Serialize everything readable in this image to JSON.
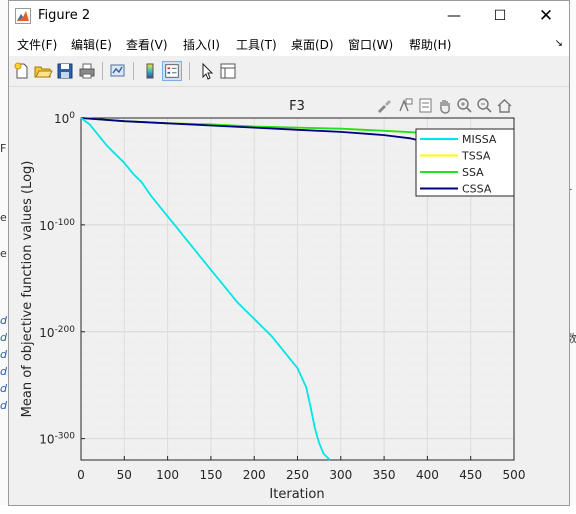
{
  "window": {
    "title": "Figure 2",
    "controls": {
      "minimize": "—",
      "maximize": "☐",
      "close": "✕"
    }
  },
  "menu": [
    "文件(F)",
    "编辑(E)",
    "查看(V)",
    "插入(I)",
    "工具(T)",
    "桌面(D)",
    "窗口(W)",
    "帮助(H)"
  ],
  "toolbar": {
    "buttons": [
      "new-figure",
      "open-file",
      "save",
      "print",
      "link-plot",
      "insert-colorbar",
      "insert-legend",
      "edit-plot",
      "property-inspector"
    ]
  },
  "axes_toolbar": [
    "brush",
    "data-tips",
    "pan",
    "zoom-in",
    "zoom-out",
    "restore-view"
  ],
  "background_fragments": {
    "left": [
      "F",
      "e",
      "e"
    ],
    "right": [
      "数"
    ]
  },
  "chart_data": {
    "type": "line",
    "title": "F3",
    "xlabel": "Iteration",
    "ylabel": "Mean of objective function values (Log)",
    "xlim": [
      0,
      500
    ],
    "ylim_exponent": [
      -320,
      0
    ],
    "yscale": "log",
    "x_ticks": [
      "0",
      "50",
      "100",
      "150",
      "200",
      "250",
      "300",
      "350",
      "400",
      "450",
      "500"
    ],
    "y_ticks": [
      {
        "base": "10",
        "exp": "0",
        "value": 0
      },
      {
        "base": "10",
        "exp": "-100",
        "value": -100
      },
      {
        "base": "10",
        "exp": "-200",
        "value": -200
      },
      {
        "base": "10",
        "exp": "-300",
        "value": -300
      }
    ],
    "grid": true,
    "legend_position": "top-right",
    "series": [
      {
        "name": "MISSA",
        "color": "#00e5e5",
        "points": [
          [
            0,
            0
          ],
          [
            10,
            -6
          ],
          [
            20,
            -16
          ],
          [
            30,
            -26
          ],
          [
            40,
            -34
          ],
          [
            50,
            -42
          ],
          [
            60,
            -52
          ],
          [
            70,
            -60
          ],
          [
            80,
            -72
          ],
          [
            90,
            -82
          ],
          [
            100,
            -92
          ],
          [
            110,
            -102
          ],
          [
            120,
            -112
          ],
          [
            130,
            -122
          ],
          [
            140,
            -132
          ],
          [
            150,
            -142
          ],
          [
            160,
            -152
          ],
          [
            170,
            -162
          ],
          [
            180,
            -172
          ],
          [
            190,
            -180
          ],
          [
            200,
            -188
          ],
          [
            210,
            -196
          ],
          [
            220,
            -204
          ],
          [
            230,
            -214
          ],
          [
            240,
            -224
          ],
          [
            250,
            -234
          ],
          [
            260,
            -252
          ],
          [
            265,
            -270
          ],
          [
            270,
            -290
          ],
          [
            275,
            -304
          ],
          [
            280,
            -314
          ],
          [
            290,
            -322
          ]
        ]
      },
      {
        "name": "TSSA",
        "color": "#ffff00",
        "points": [
          [
            0,
            0
          ],
          [
            50,
            -3
          ],
          [
            100,
            -5
          ],
          [
            150,
            -6
          ],
          [
            200,
            -8
          ],
          [
            250,
            -9
          ],
          [
            300,
            -10
          ],
          [
            350,
            -12
          ],
          [
            400,
            -14
          ],
          [
            450,
            -17
          ],
          [
            500,
            -22
          ]
        ]
      },
      {
        "name": "SSA",
        "color": "#22e022",
        "points": [
          [
            0,
            0
          ],
          [
            50,
            -3
          ],
          [
            100,
            -5
          ],
          [
            150,
            -6
          ],
          [
            200,
            -8
          ],
          [
            250,
            -9
          ],
          [
            300,
            -10
          ],
          [
            350,
            -12
          ],
          [
            400,
            -14
          ],
          [
            450,
            -16
          ],
          [
            500,
            -20
          ]
        ]
      },
      {
        "name": "CSSA",
        "color": "#000080",
        "points": [
          [
            0,
            0
          ],
          [
            50,
            -3
          ],
          [
            100,
            -5
          ],
          [
            150,
            -7
          ],
          [
            200,
            -9
          ],
          [
            250,
            -11
          ],
          [
            300,
            -13
          ],
          [
            350,
            -16
          ],
          [
            380,
            -19
          ],
          [
            410,
            -25
          ],
          [
            440,
            -27
          ],
          [
            470,
            -28
          ],
          [
            500,
            -30
          ]
        ]
      }
    ]
  }
}
